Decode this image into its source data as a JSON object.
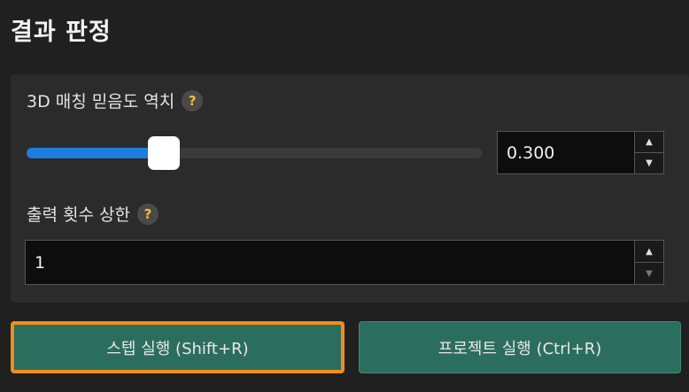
{
  "section": {
    "title": "결과 판정"
  },
  "threshold": {
    "label": "3D 매칭 믿음도 역치",
    "help": "?",
    "value": "0.300",
    "slider_fraction": 0.3
  },
  "output_limit": {
    "label": "출력 횟수 상한",
    "help": "?",
    "value": "1"
  },
  "buttons": {
    "step_run": "스텝 실행 (Shift+R)",
    "project_run": "프로젝트 실행 (Ctrl+R)"
  },
  "icons": {
    "up": "▲",
    "down": "▼"
  }
}
